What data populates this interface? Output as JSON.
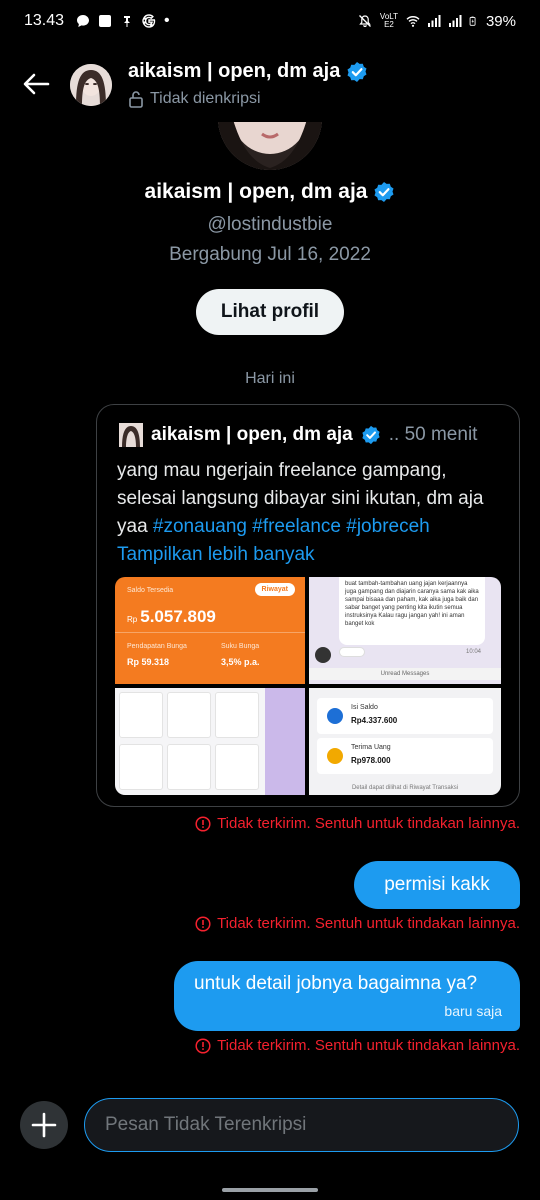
{
  "status_bar": {
    "time": "13.43",
    "volte": "VoLTE2",
    "battery": "39%"
  },
  "header": {
    "name": "aikaism | open, dm aja",
    "encryption_status": "Tidak dienkripsi"
  },
  "profile": {
    "name": "aikaism | open, dm aja",
    "handle": "@lostindustbie",
    "joined": "Bergabung Jul 16, 2022",
    "button_label": "Lihat profil"
  },
  "day_separator": "Hari ini",
  "shared_post": {
    "author": "aikaism | open, dm aja",
    "time": ".. 50 menit",
    "text": "yang mau ngerjain freelance gampang, selesai langsung dibayar sini ikutan, dm aja yaa",
    "hashtags": [
      "#zonauang",
      "#freelance",
      "#jobreceh"
    ],
    "show_more": "Tampilkan lebih banyak",
    "media": {
      "saldo_label": "Saldo Tersedia",
      "saldo_currency": "Rp",
      "saldo_value": "5.057.809",
      "riwayat_label": "Riwayat",
      "interest_income_label": "Pendapatan Bunga",
      "interest_income_value": "Rp 59.318",
      "interest_rate_label": "Suku Bunga",
      "interest_rate_value": "3,5% p.a.",
      "chat_text": "buat tambah-tambahan uang jajan kerjaannya juga gampang dan diajarin caranya sama kak aika sampai bisaaa dan paham, kak aika juga baik dan sabar banget yang penting kita ikutin semua instruksinya Kalau ragu jangan yah! ini aman banget kok",
      "chat_time": "10:04",
      "unread_label": "Unread Messages",
      "isi_saldo_label": "Isi Saldo",
      "isi_saldo_value": "Rp4.337.600",
      "terima_uang_label": "Terima Uang",
      "terima_uang_value": "Rp978.000",
      "detail_note": "Detail dapat dilihat di Riwayat Transaksi"
    }
  },
  "error_text": "Tidak terkirim. Sentuh untuk tindakan lainnya.",
  "messages": [
    {
      "text": "permisi kakk"
    },
    {
      "text": "untuk detail jobnya bagaimna ya?",
      "timestamp": "baru saja"
    }
  ],
  "composer": {
    "placeholder": "Pesan Tidak Terenkripsi"
  },
  "colors": {
    "accent": "#1d9bf0",
    "error": "#f4212e",
    "background": "#000000",
    "muted": "#8b98a5"
  }
}
